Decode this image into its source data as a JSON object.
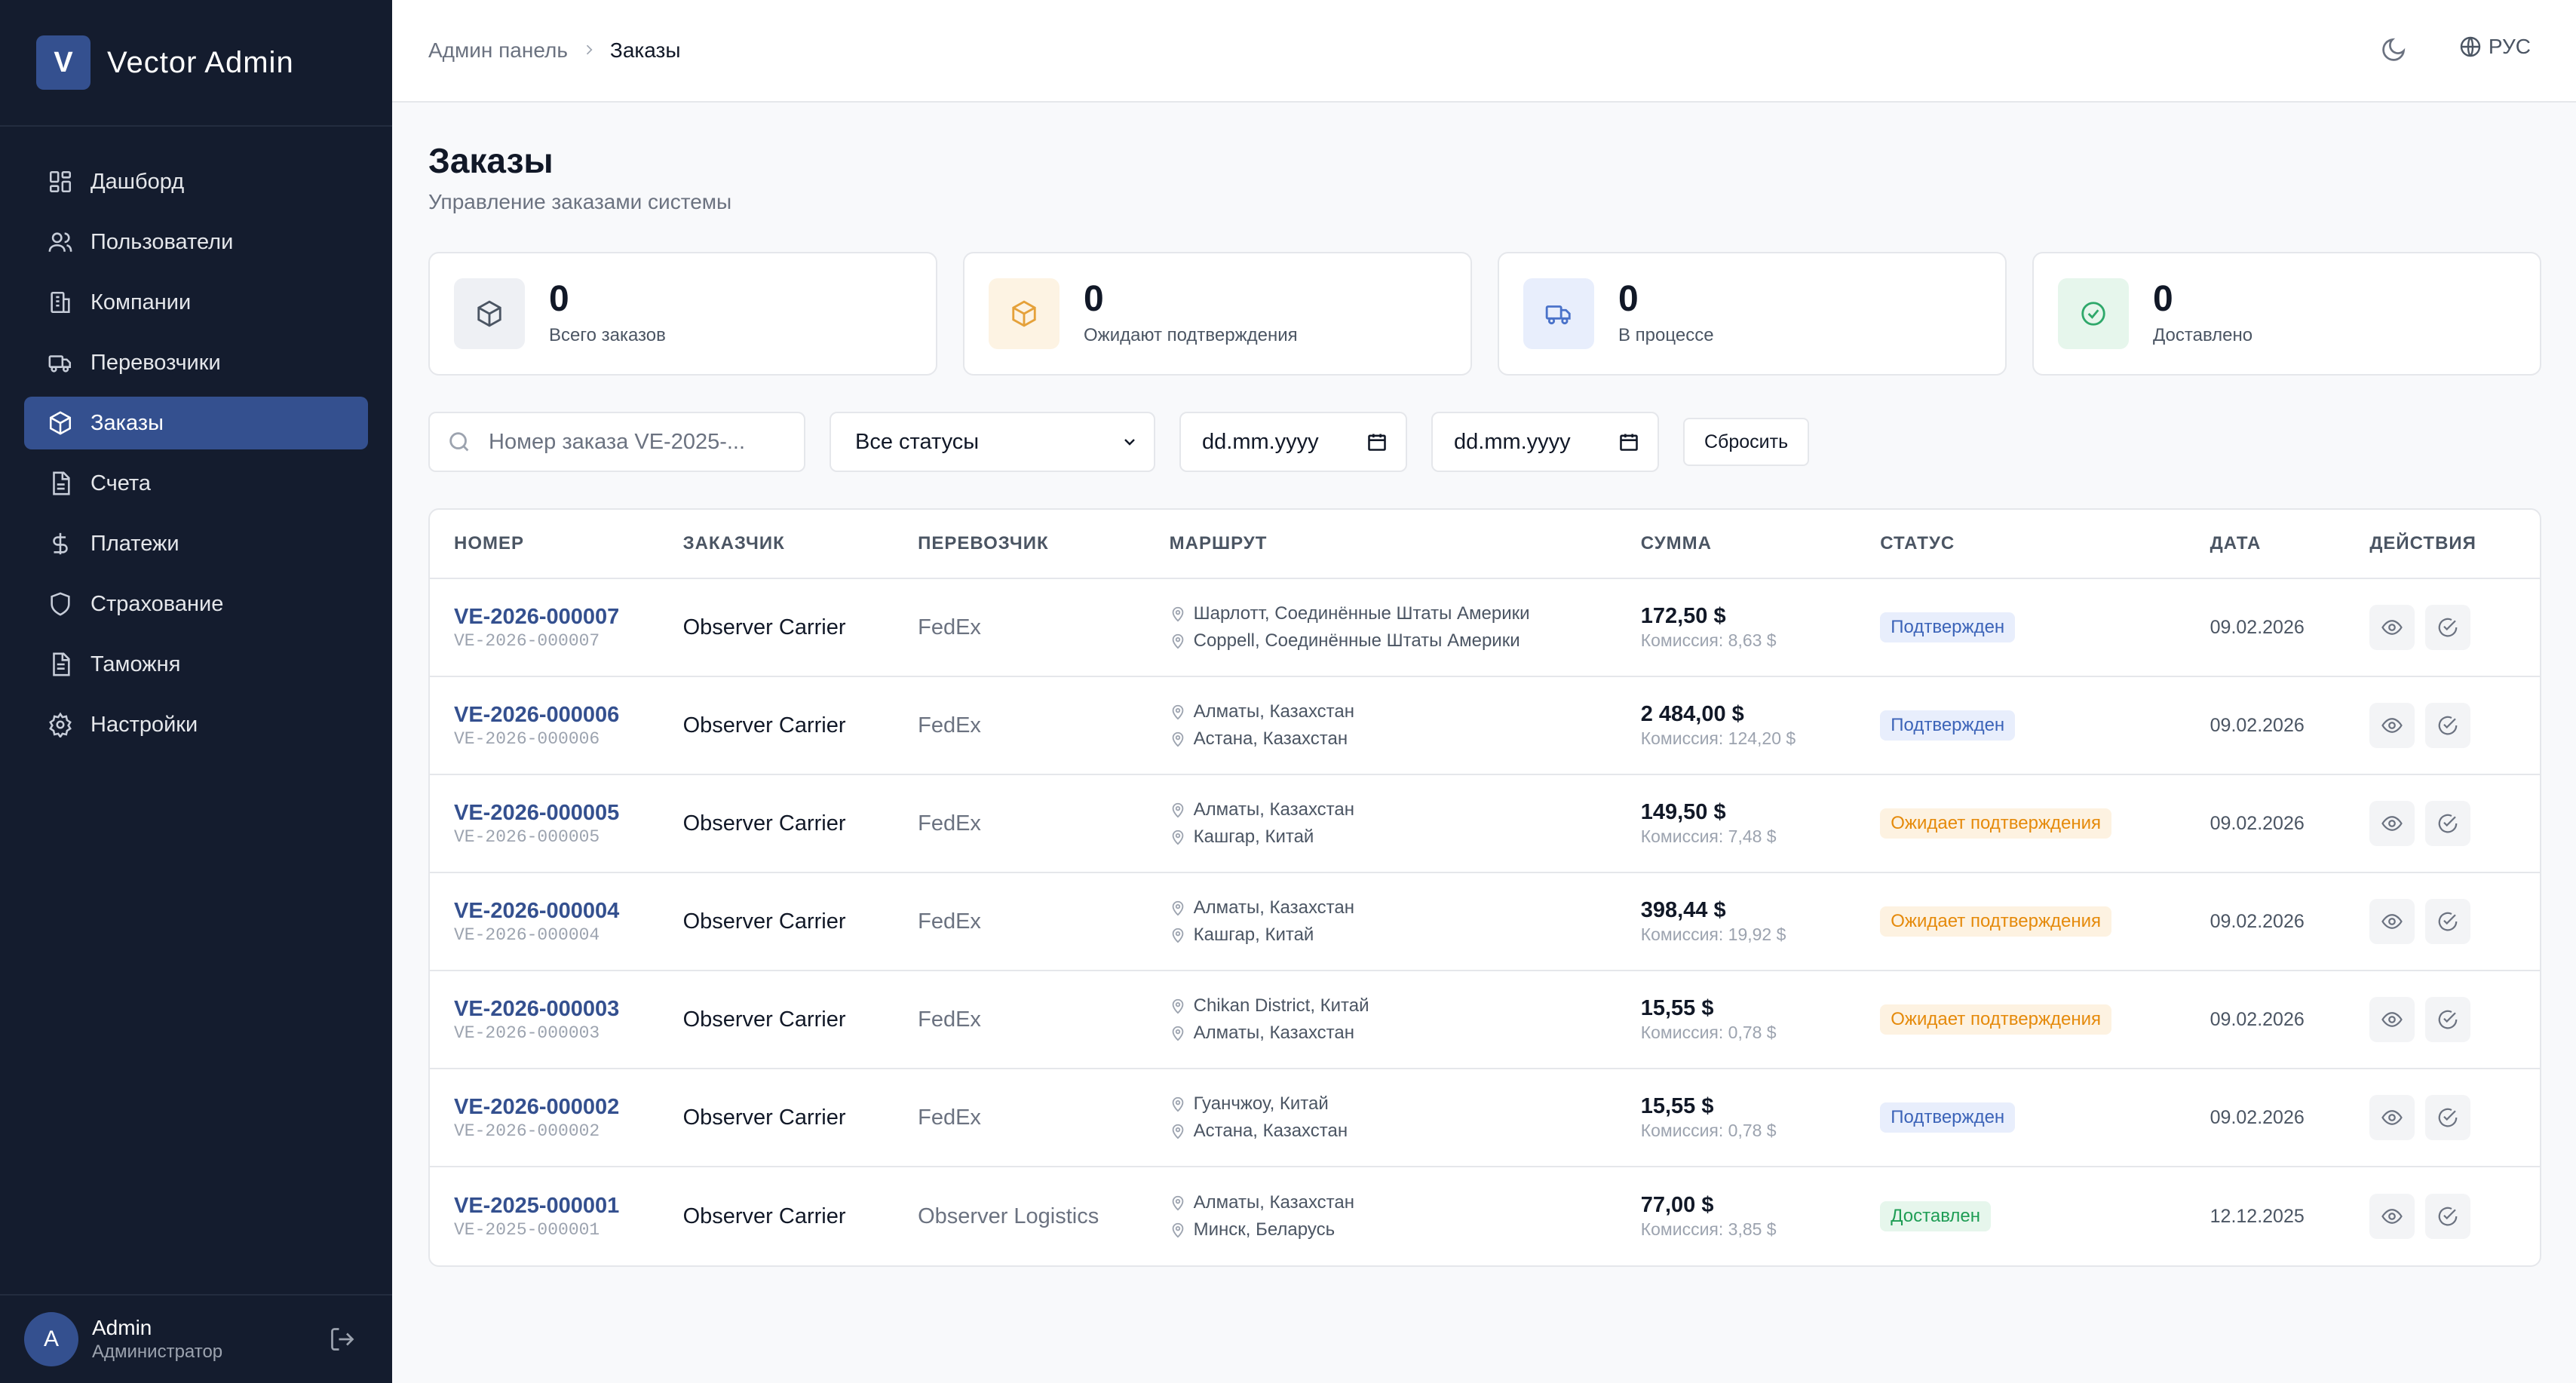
{
  "app": {
    "logo_letter": "V",
    "name": "Vector Admin"
  },
  "sidebar": {
    "items": [
      {
        "label": "Дашборд",
        "icon": "dashboard-icon"
      },
      {
        "label": "Пользователи",
        "icon": "users-icon"
      },
      {
        "label": "Компании",
        "icon": "building-icon"
      },
      {
        "label": "Перевозчики",
        "icon": "truck-icon"
      },
      {
        "label": "Заказы",
        "icon": "package-icon",
        "active": true
      },
      {
        "label": "Счета",
        "icon": "file-icon"
      },
      {
        "label": "Платежи",
        "icon": "dollar-icon"
      },
      {
        "label": "Страхование",
        "icon": "shield-icon"
      },
      {
        "label": "Таможня",
        "icon": "document-icon"
      },
      {
        "label": "Настройки",
        "icon": "gear-icon"
      }
    ],
    "user": {
      "initial": "A",
      "name": "Admin",
      "role": "Администратор"
    }
  },
  "header": {
    "breadcrumb_root": "Админ панель",
    "breadcrumb_current": "Заказы",
    "language": "РУС"
  },
  "page": {
    "title": "Заказы",
    "subtitle": "Управление заказами системы"
  },
  "stats": [
    {
      "value": "0",
      "label": "Всего заказов",
      "icon": "package-icon",
      "color": "#4b5563",
      "bg": "#eef0f4"
    },
    {
      "value": "0",
      "label": "Ожидают подтверждения",
      "icon": "package-icon",
      "color": "#e5a13a",
      "bg": "#fdf3e3"
    },
    {
      "value": "0",
      "label": "В процессе",
      "icon": "truck-icon",
      "color": "#4a72c9",
      "bg": "#e8eefc"
    },
    {
      "value": "0",
      "label": "Доставлено",
      "icon": "check-circle-icon",
      "color": "#2ea86a",
      "bg": "#e6f6ec"
    }
  ],
  "filters": {
    "search_placeholder": "Номер заказа VE-2025-...",
    "status_value": "Все статусы",
    "date_from": "dd.mm.yyyy",
    "date_to": "dd.mm.yyyy",
    "reset_label": "Сбросить"
  },
  "table": {
    "headers": {
      "number": "НОМЕР",
      "customer": "ЗАКАЗЧИК",
      "carrier": "ПЕРЕВОЗЧИК",
      "route": "МАРШРУТ",
      "sum": "СУММА",
      "status": "СТАТУС",
      "date": "ДАТА",
      "actions": "ДЕЙСТВИЯ"
    },
    "rows": [
      {
        "number": "VE-2026-000007",
        "sub": "VE-2026-000007",
        "customer": "Observer Carrier",
        "carrier": "FedEx",
        "from": "Шарлотт, Соединённые Штаты Америки",
        "to": "Coppell, Соединённые Штаты Америки",
        "amount": "172,50 $",
        "commission": "Комиссия: 8,63 $",
        "status": "Подтвержден",
        "status_type": "confirmed",
        "date": "09.02.2026"
      },
      {
        "number": "VE-2026-000006",
        "sub": "VE-2026-000006",
        "customer": "Observer Carrier",
        "carrier": "FedEx",
        "from": "Алматы, Казахстан",
        "to": "Астана, Казахстан",
        "amount": "2 484,00 $",
        "commission": "Комиссия: 124,20 $",
        "status": "Подтвержден",
        "status_type": "confirmed",
        "date": "09.02.2026"
      },
      {
        "number": "VE-2026-000005",
        "sub": "VE-2026-000005",
        "customer": "Observer Carrier",
        "carrier": "FedEx",
        "from": "Алматы, Казахстан",
        "to": "Кашгар, Китай",
        "amount": "149,50 $",
        "commission": "Комиссия: 7,48 $",
        "status": "Ожидает подтверждения",
        "status_type": "pending",
        "date": "09.02.2026"
      },
      {
        "number": "VE-2026-000004",
        "sub": "VE-2026-000004",
        "customer": "Observer Carrier",
        "carrier": "FedEx",
        "from": "Алматы, Казахстан",
        "to": "Кашгар, Китай",
        "amount": "398,44 $",
        "commission": "Комиссия: 19,92 $",
        "status": "Ожидает подтверждения",
        "status_type": "pending",
        "date": "09.02.2026"
      },
      {
        "number": "VE-2026-000003",
        "sub": "VE-2026-000003",
        "customer": "Observer Carrier",
        "carrier": "FedEx",
        "from": "Chikan District, Китай",
        "to": "Алматы, Казахстан",
        "amount": "15,55 $",
        "commission": "Комиссия: 0,78 $",
        "status": "Ожидает подтверждения",
        "status_type": "pending",
        "date": "09.02.2026"
      },
      {
        "number": "VE-2026-000002",
        "sub": "VE-2026-000002",
        "customer": "Observer Carrier",
        "carrier": "FedEx",
        "from": "Гуанчжоу, Китай",
        "to": "Астана, Казахстан",
        "amount": "15,55 $",
        "commission": "Комиссия: 0,78 $",
        "status": "Подтвержден",
        "status_type": "confirmed",
        "date": "09.02.2026"
      },
      {
        "number": "VE-2025-000001",
        "sub": "VE-2025-000001",
        "customer": "Observer Carrier",
        "carrier": "Observer Logistics",
        "from": "Алматы, Казахстан",
        "to": "Минск, Беларусь",
        "amount": "77,00 $",
        "commission": "Комиссия: 3,85 $",
        "status": "Доставлен",
        "status_type": "delivered",
        "date": "12.12.2025"
      }
    ]
  }
}
